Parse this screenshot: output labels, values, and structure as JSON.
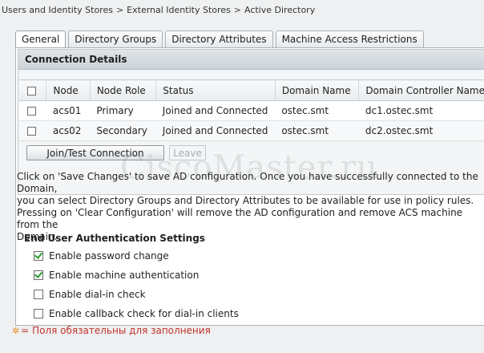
{
  "breadcrumb": {
    "items": [
      "Users and Identity Stores",
      "External Identity Stores",
      "Active Directory"
    ],
    "separator": ">"
  },
  "tabs": [
    {
      "label": "General",
      "active": true
    },
    {
      "label": "Directory Groups",
      "active": false
    },
    {
      "label": "Directory Attributes",
      "active": false
    },
    {
      "label": "Machine Access Restrictions",
      "active": false
    }
  ],
  "connection": {
    "title": "Connection Details",
    "columns": [
      "Node",
      "Node Role",
      "Status",
      "Domain Name",
      "Domain Controller Name"
    ],
    "rows": [
      {
        "checked": false,
        "node": "acs01",
        "role": "Primary",
        "status": "Joined and Connected",
        "domain": "ostec.smt",
        "controller": "dc1.ostec.smt"
      },
      {
        "checked": false,
        "node": "acs02",
        "role": "Secondary",
        "status": "Joined and Connected",
        "domain": "ostec.smt",
        "controller": "dc2.ostec.smt"
      }
    ],
    "join_button": "Join/Test Connection",
    "leave_button": "Leave"
  },
  "info_lines": [
    "Click on 'Save Changes' to save AD configuration. Once you have successfully connected to the Domain,",
    "you can select Directory Groups and Directory Attributes to be available for use in policy rules.",
    "Pressing on 'Clear Configuration' will remove the AD configuration and remove ACS machine from the",
    "Domain."
  ],
  "auth_settings": {
    "title": "End User Authentication Settings",
    "options": [
      {
        "label": "Enable password change",
        "checked": true
      },
      {
        "label": "Enable machine authentication",
        "checked": true
      },
      {
        "label": "Enable dial-in check",
        "checked": false
      },
      {
        "label": "Enable callback check for dial-in clients",
        "checked": false
      }
    ]
  },
  "required_note": {
    "star": "✲",
    "text": "= Поля обязательны для заполнения"
  },
  "watermark": "CiscoMaster.ru",
  "colors": {
    "accent_check": "#2a9a2a",
    "required_text": "#c2342c",
    "required_star": "#e38a1c"
  }
}
